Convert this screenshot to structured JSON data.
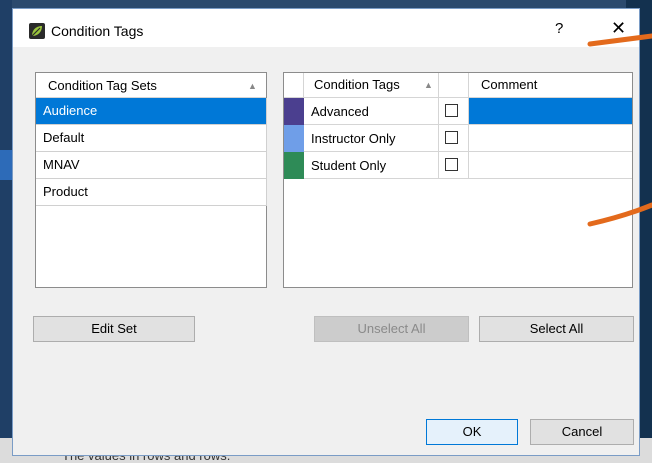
{
  "background": {
    "bottom_text": "The values in rows and rows."
  },
  "dialog": {
    "title": "Condition Tags",
    "help_label": "?",
    "close_label": "✕"
  },
  "tag_sets": {
    "header": "Condition Tag Sets",
    "items": [
      "Audience",
      "Default",
      "MNAV",
      "Product"
    ],
    "selected_index": 0
  },
  "tags": {
    "headers": {
      "tag": "Condition Tags",
      "comment": "Comment"
    },
    "rows": [
      {
        "name": "Advanced",
        "color": "#4b3f8f",
        "checked": false,
        "comment": ""
      },
      {
        "name": "Instructor Only",
        "color": "#6f9ee8",
        "checked": false,
        "comment": ""
      },
      {
        "name": "Student Only",
        "color": "#2e8b57",
        "checked": false,
        "comment": ""
      }
    ]
  },
  "buttons": {
    "edit_set": "Edit Set",
    "unselect_all": "Unselect All",
    "select_all": "Select All",
    "ok": "OK",
    "cancel": "Cancel"
  },
  "colors": {
    "accent": "#0078d7",
    "annotation": "#e36a1c"
  }
}
